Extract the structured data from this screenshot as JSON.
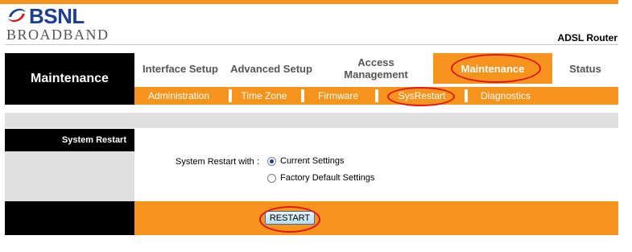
{
  "brand": {
    "name": "BSNL",
    "subtitle": "BROADBAND",
    "device": "ADSL Router"
  },
  "section_title": "Maintenance",
  "main_tabs": [
    {
      "label": "Interface Setup",
      "active": false
    },
    {
      "label": "Advanced Setup",
      "active": false
    },
    {
      "label": "Access Management",
      "active": false
    },
    {
      "label": "Maintenance",
      "active": true
    },
    {
      "label": "Status",
      "active": false
    }
  ],
  "sub_tabs": [
    {
      "label": "Administration",
      "active": false
    },
    {
      "label": "Time Zone",
      "active": false
    },
    {
      "label": "Firmware",
      "active": false
    },
    {
      "label": "SysRestart",
      "active": true
    },
    {
      "label": "Diagnostics",
      "active": false
    }
  ],
  "panel": {
    "label": "System Restart",
    "restart_with_label": "System Restart with :",
    "options": [
      {
        "label": "Current Settings",
        "checked": true
      },
      {
        "label": "Factory Default Settings",
        "checked": false
      }
    ],
    "restart_button": "RESTART"
  },
  "colors": {
    "accent": "#f7941d",
    "dark": "#000000",
    "highlight": "#e0161e",
    "brand_blue": "#1b3e8f"
  }
}
